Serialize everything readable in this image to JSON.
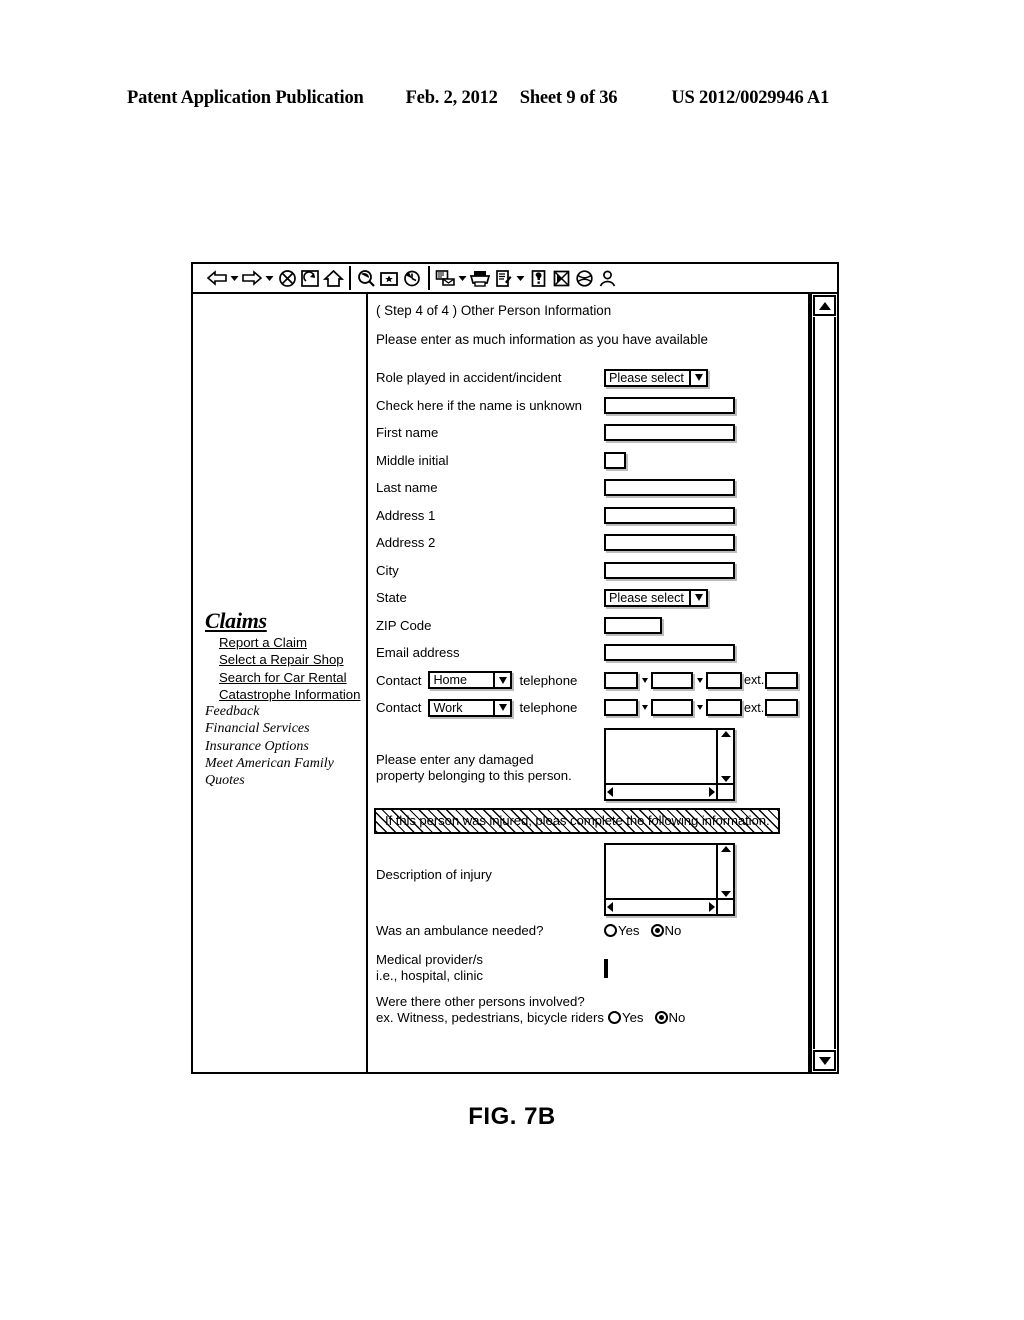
{
  "patent_header": {
    "publication": "Patent Application Publication",
    "date": "Feb. 2, 2012",
    "sheet": "Sheet 9 of 36",
    "number": "US 2012/0029946 A1"
  },
  "figure": {
    "caption": "FIG. 7B"
  },
  "browser": {
    "toolbar": {
      "icons": [
        {
          "name": "back-arrow-icon",
          "label": "Back"
        },
        {
          "name": "back-dropdown-icon",
          "label": "Back history"
        },
        {
          "name": "forward-arrow-icon",
          "label": "Forward"
        },
        {
          "name": "forward-dropdown-icon",
          "label": "Forward history"
        },
        {
          "name": "stop-icon",
          "label": "Stop"
        },
        {
          "name": "refresh-icon",
          "label": "Refresh"
        },
        {
          "name": "home-icon",
          "label": "Home"
        },
        {
          "name": "search-icon",
          "label": "Search"
        },
        {
          "name": "favorites-icon",
          "label": "Favorites"
        },
        {
          "name": "history-icon",
          "label": "History"
        },
        {
          "name": "mail-icon",
          "label": "Mail"
        },
        {
          "name": "mail-dropdown-icon",
          "label": "Mail options"
        },
        {
          "name": "print-icon",
          "label": "Print"
        },
        {
          "name": "edit-icon",
          "label": "Edit"
        },
        {
          "name": "edit-dropdown-icon",
          "label": "Edit options"
        },
        {
          "name": "discuss-icon",
          "label": "Discuss"
        },
        {
          "name": "messenger-icon",
          "label": "Messenger"
        },
        {
          "name": "realplayer-icon",
          "label": "Media"
        },
        {
          "name": "person-icon",
          "label": "Person"
        }
      ]
    },
    "scrollbar": {
      "up_arrow": "▲",
      "down_arrow": "▼"
    }
  },
  "sidebar": {
    "heading": "Claims",
    "links": [
      "Report a Claim",
      "Select a Repair Shop",
      "Search for Car Rental",
      "Catastrophe Information"
    ],
    "items": [
      "Feedback",
      "Financial Services",
      "Insurance Options",
      "Meet American Family",
      "Quotes"
    ]
  },
  "form": {
    "step_title": "( Step 4 of 4 ) Other Person Information",
    "instruction": "Please enter as much information as you have available",
    "fields": {
      "role_label": "Role played in accident/incident",
      "role_value": "Please select",
      "name_unknown_label": "Check here if the name is unknown",
      "first_name_label": "First name",
      "middle_initial_label": "Middle initial",
      "last_name_label": "Last name",
      "address1_label": "Address 1",
      "address2_label": "Address 2",
      "city_label": "City",
      "state_label": "State",
      "state_value": "Please select",
      "zip_label": "ZIP Code",
      "email_label": "Email address"
    },
    "contact1": {
      "prefix": "Contact",
      "type_value": "Home",
      "suffix": "telephone",
      "ext_label": "ext."
    },
    "contact2": {
      "prefix": "Contact",
      "type_value": "Work",
      "suffix": "telephone",
      "ext_label": "ext."
    },
    "damaged_property": {
      "line1": "Please enter any damaged",
      "line2": "property belonging to this person."
    },
    "injury_banner": "If this person was injured, pleas complete the following information.",
    "injury": {
      "description_label": "Description of injury",
      "ambulance_label": "Was an ambulance needed?",
      "ambulance_yes": "Yes",
      "ambulance_no": "No",
      "ambulance_selected": "No",
      "provider_line1": "Medical provider/s",
      "provider_line2": "i.e., hospital, clinic",
      "others_line1": "Were there other persons involved?",
      "others_line2": "ex. Witness, pedestrians, bicycle riders",
      "others_yes": "Yes",
      "others_no": "No",
      "others_selected": "No"
    }
  },
  "colors": {
    "ink": "#000000",
    "paper": "#ffffff",
    "field_shadow": "#bdbdbd"
  }
}
